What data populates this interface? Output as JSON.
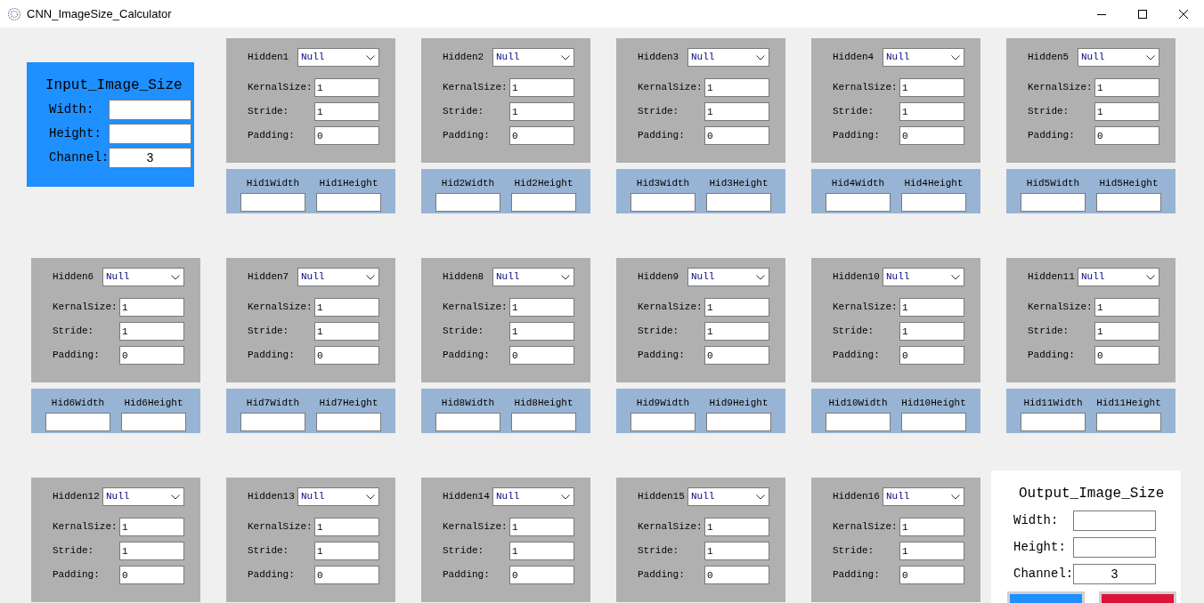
{
  "window": {
    "title": "CNN_ImageSize_Calculator"
  },
  "input_image_size": {
    "title": "Input_Image_Size",
    "fields": [
      {
        "label": "Width:"
      },
      {
        "label": "Height:"
      },
      {
        "label": "Channel:",
        "value": "3"
      }
    ]
  },
  "hidden_layers": [
    {
      "label": "Hidden1",
      "select": "Null",
      "params": [
        {
          "label": "KernalSize:",
          "value": "1"
        },
        {
          "label": "Stride:",
          "value": "1"
        },
        {
          "label": "Padding:",
          "value": "0"
        }
      ],
      "outputs": [
        {
          "label": "Hid1Width"
        },
        {
          "label": "Hid1Height"
        }
      ]
    },
    {
      "label": "Hidden2",
      "select": "Null",
      "params": [
        {
          "label": "KernalSize:",
          "value": "1"
        },
        {
          "label": "Stride:",
          "value": "1"
        },
        {
          "label": "Padding:",
          "value": "0"
        }
      ],
      "outputs": [
        {
          "label": "Hid2Width"
        },
        {
          "label": "Hid2Height"
        }
      ]
    },
    {
      "label": "Hidden3",
      "select": "Null",
      "params": [
        {
          "label": "KernalSize:",
          "value": "1"
        },
        {
          "label": "Stride:",
          "value": "1"
        },
        {
          "label": "Padding:",
          "value": "0"
        }
      ],
      "outputs": [
        {
          "label": "Hid3Width"
        },
        {
          "label": "Hid3Height"
        }
      ]
    },
    {
      "label": "Hidden4",
      "select": "Null",
      "params": [
        {
          "label": "KernalSize:",
          "value": "1"
        },
        {
          "label": "Stride:",
          "value": "1"
        },
        {
          "label": "Padding:",
          "value": "0"
        }
      ],
      "outputs": [
        {
          "label": "Hid4Width"
        },
        {
          "label": "Hid4Height"
        }
      ]
    },
    {
      "label": "Hidden5",
      "select": "Null",
      "params": [
        {
          "label": "KernalSize:",
          "value": "1"
        },
        {
          "label": "Stride:",
          "value": "1"
        },
        {
          "label": "Padding:",
          "value": "0"
        }
      ],
      "outputs": [
        {
          "label": "Hid5Width"
        },
        {
          "label": "Hid5Height"
        }
      ]
    },
    {
      "label": "Hidden6",
      "select": "Null",
      "params": [
        {
          "label": "KernalSize:",
          "value": "1"
        },
        {
          "label": "Stride:",
          "value": "1"
        },
        {
          "label": "Padding:",
          "value": "0"
        }
      ],
      "outputs": [
        {
          "label": "Hid6Width"
        },
        {
          "label": "Hid6Height"
        }
      ]
    },
    {
      "label": "Hidden7",
      "select": "Null",
      "params": [
        {
          "label": "KernalSize:",
          "value": "1"
        },
        {
          "label": "Stride:",
          "value": "1"
        },
        {
          "label": "Padding:",
          "value": "0"
        }
      ],
      "outputs": [
        {
          "label": "Hid7Width"
        },
        {
          "label": "Hid7Height"
        }
      ]
    },
    {
      "label": "Hidden8",
      "select": "Null",
      "params": [
        {
          "label": "KernalSize:",
          "value": "1"
        },
        {
          "label": "Stride:",
          "value": "1"
        },
        {
          "label": "Padding:",
          "value": "0"
        }
      ],
      "outputs": [
        {
          "label": "Hid8Width"
        },
        {
          "label": "Hid8Height"
        }
      ]
    },
    {
      "label": "Hidden9",
      "select": "Null",
      "params": [
        {
          "label": "KernalSize:",
          "value": "1"
        },
        {
          "label": "Stride:",
          "value": "1"
        },
        {
          "label": "Padding:",
          "value": "0"
        }
      ],
      "outputs": [
        {
          "label": "Hid9Width"
        },
        {
          "label": "Hid9Height"
        }
      ]
    },
    {
      "label": "Hidden10",
      "select": "Null",
      "params": [
        {
          "label": "KernalSize:",
          "value": "1"
        },
        {
          "label": "Stride:",
          "value": "1"
        },
        {
          "label": "Padding:",
          "value": "0"
        }
      ],
      "outputs": [
        {
          "label": "Hid10Width"
        },
        {
          "label": "Hid10Height"
        }
      ]
    },
    {
      "label": "Hidden11",
      "select": "Null",
      "params": [
        {
          "label": "KernalSize:",
          "value": "1"
        },
        {
          "label": "Stride:",
          "value": "1"
        },
        {
          "label": "Padding:",
          "value": "0"
        }
      ],
      "outputs": [
        {
          "label": "Hid11Width"
        },
        {
          "label": "Hid11Height"
        }
      ]
    },
    {
      "label": "Hidden12",
      "select": "Null",
      "params": [
        {
          "label": "KernalSize:",
          "value": "1"
        },
        {
          "label": "Stride:",
          "value": "1"
        },
        {
          "label": "Padding:",
          "value": "0"
        }
      ]
    },
    {
      "label": "Hidden13",
      "select": "Null",
      "params": [
        {
          "label": "KernalSize:",
          "value": "1"
        },
        {
          "label": "Stride:",
          "value": "1"
        },
        {
          "label": "Padding:",
          "value": "0"
        }
      ]
    },
    {
      "label": "Hidden14",
      "select": "Null",
      "params": [
        {
          "label": "KernalSize:",
          "value": "1"
        },
        {
          "label": "Stride:",
          "value": "1"
        },
        {
          "label": "Padding:",
          "value": "0"
        }
      ]
    },
    {
      "label": "Hidden15",
      "select": "Null",
      "params": [
        {
          "label": "KernalSize:",
          "value": "1"
        },
        {
          "label": "Stride:",
          "value": "1"
        },
        {
          "label": "Padding:",
          "value": "0"
        }
      ]
    },
    {
      "label": "Hidden16",
      "select": "Null",
      "params": [
        {
          "label": "KernalSize:",
          "value": "1"
        },
        {
          "label": "Stride:",
          "value": "1"
        },
        {
          "label": "Padding:",
          "value": "0"
        }
      ]
    }
  ],
  "output_image_size": {
    "title": "Output_Image_Size",
    "fields": [
      {
        "label": "Width:"
      },
      {
        "label": "Height:"
      },
      {
        "label": "Channel:",
        "value": "3"
      }
    ],
    "buttons": [
      {
        "color": "#1e90ff"
      },
      {
        "color": "#dc143c"
      }
    ]
  }
}
